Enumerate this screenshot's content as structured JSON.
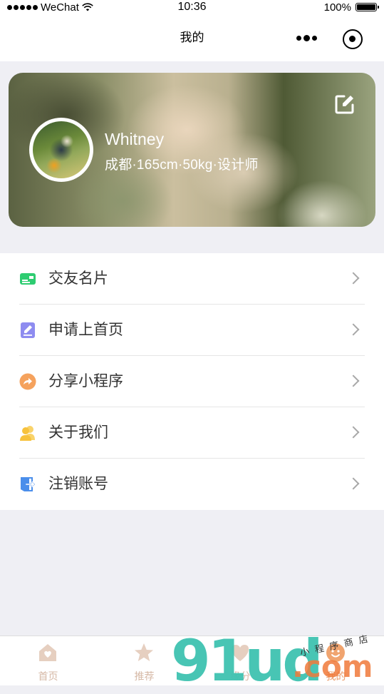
{
  "status_bar": {
    "carrier": "WeChat",
    "time": "10:36",
    "battery_percent": "100%"
  },
  "navbar": {
    "title": "我的"
  },
  "profile": {
    "name": "Whitney",
    "info": "成都·165cm·50kg·设计师"
  },
  "menu": {
    "items": [
      {
        "label": "交友名片",
        "icon": "id-card-icon",
        "color": "#2ECC71"
      },
      {
        "label": "申请上首页",
        "icon": "edit-note-icon",
        "color": "#8E8CF0"
      },
      {
        "label": "分享小程序",
        "icon": "share-icon",
        "color": "#F5A25D"
      },
      {
        "label": "关于我们",
        "icon": "users-icon",
        "color": "#F7C23C"
      },
      {
        "label": "注销账号",
        "icon": "logout-icon",
        "color": "#4A8EEB"
      }
    ]
  },
  "tabbar": {
    "items": [
      {
        "label": "首页",
        "icon": "home-icon"
      },
      {
        "label": "推荐",
        "icon": "star-icon"
      },
      {
        "label": "缘分",
        "icon": "heart-icon"
      },
      {
        "label": "我的",
        "icon": "user-icon"
      }
    ]
  },
  "watermark": {
    "logo": "91ud",
    "domain": ".com",
    "tagline": "小程序商店"
  },
  "colors": {
    "accent": "#E99A6A",
    "tab_inactive": "#D6B9A6",
    "background": "#EFEFF4"
  }
}
